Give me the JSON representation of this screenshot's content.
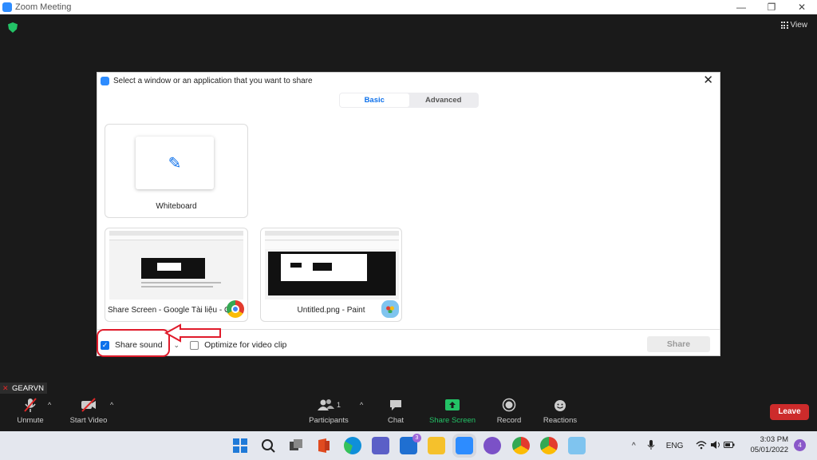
{
  "window": {
    "title": "Zoom Meeting",
    "controls": [
      "—",
      "❐",
      "✕"
    ]
  },
  "top_right": {
    "view_label": "View"
  },
  "dialog": {
    "title": "Select a window or an application that you want to share",
    "close": "✕",
    "tabs": [
      {
        "label": "Basic",
        "active": true
      },
      {
        "label": "Advanced",
        "active": false
      }
    ],
    "items": [
      {
        "label": "Whiteboard"
      },
      {
        "label": "Share Screen - Google Tài liệu - G..."
      },
      {
        "label": "Untitled.png - Paint"
      }
    ],
    "options": {
      "share_sound_label": "Share sound",
      "share_sound_checked": true,
      "optimize_label": "Optimize for video clip",
      "optimize_checked": false
    },
    "share_button": "Share"
  },
  "participant_tag": {
    "name": "GEARVN"
  },
  "toolbar": {
    "unmute": "Unmute",
    "start_video": "Start Video",
    "participants": "Participants",
    "participants_count": "1",
    "chat": "Chat",
    "share_screen": "Share Screen",
    "record": "Record",
    "reactions": "Reactions",
    "leave": "Leave"
  },
  "taskbar": {
    "mail_badge": "3",
    "teams_badge": "",
    "lang": "ENG",
    "time": "3:03 PM",
    "date": "05/01/2022",
    "notifications": "4"
  },
  "colors": {
    "zoom_blue": "#0e71eb",
    "leave_red": "#cd2b2b",
    "share_green": "#23c266",
    "annotation_red": "#e01b2b"
  }
}
